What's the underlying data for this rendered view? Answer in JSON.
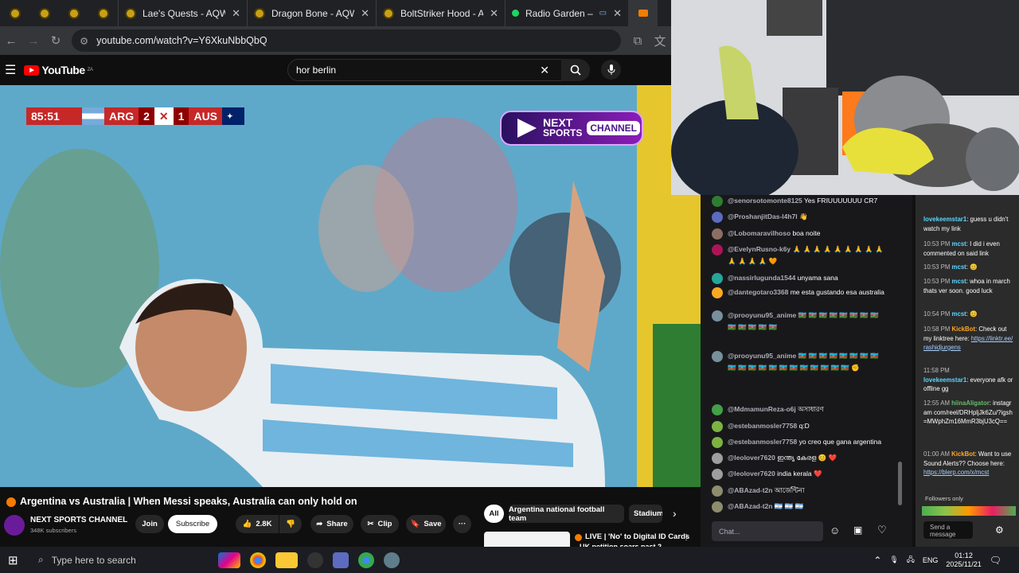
{
  "browser": {
    "tabs": [
      {
        "label": "Lae's Quests - AQW",
        "close": "✕"
      },
      {
        "label": "Dragon Bone - AQW",
        "close": "✕"
      },
      {
        "label": "BoltStriker Hood - AQW",
        "close": "✕"
      },
      {
        "label": "Radio Garden – Glob",
        "close": "✕"
      }
    ],
    "url": "youtube.com/watch?v=Y6XkuNbbQbQ"
  },
  "youtube": {
    "logo": "YouTube",
    "region": "ZA",
    "search_value": "hor berlin",
    "clear": "✕"
  },
  "video": {
    "clock": "85:51",
    "team1": "ARG",
    "score1": "2",
    "score2": "1",
    "team2": "AUS",
    "badge_line1": "NEXT",
    "badge_line2": "SPORTS",
    "badge_line3": "CHANNEL",
    "title": "Argentina vs Australia | When Messi speaks, Australia can only hold on",
    "channel_name": "NEXT SPORTS CHANNEL",
    "subscribers": "348K subscribers",
    "join": "Join",
    "subscribe": "Subscribe",
    "likes": "2.8K",
    "share": "Share",
    "clip": "Clip",
    "save": "Save",
    "more": "···"
  },
  "related": {
    "chips": [
      "All",
      "Argentina national football team",
      "Stadium"
    ],
    "next_title": "LIVE | 'No' to Digital ID Cards",
    "next_sub": "UK petition soars past 2"
  },
  "chat": {
    "messages": [
      {
        "user": "@senorsotomonte8125",
        "text": "Yes FRIUUUUUUU CR7",
        "color": "#2e7d32"
      },
      {
        "user": "@ProshanjitDas-l4h7l",
        "text": "👋",
        "color": "#5c6bc0"
      },
      {
        "user": "@Lobomaravilhoso",
        "text": "boa noite",
        "color": "#8d6e63"
      },
      {
        "user": "@EvelynRusno-k6y",
        "text": "🙏 🙏 🙏 🙏 🙏 🙏 🙏 🙏 🙏 🙏 🙏 🙏 🙏 🧡",
        "color": "#ad1457"
      },
      {
        "user": "@nassirlugunda1544",
        "text": "unyama sana",
        "color": "#26a69a"
      },
      {
        "user": "@dantegotaro3368",
        "text": "me esta gustando esa australia",
        "color": "#f9a825"
      },
      {
        "user": "@prooyunu95_anime",
        "text": "🇦🇿 🇦🇿 🇦🇿 🇦🇿 🇦🇿 🇦🇿 🇦🇿 🇦🇿 🇦🇿 🇦🇿 🇦🇿 🇦🇿 🇦🇿",
        "color": "#78909c"
      },
      {
        "user": "@prooyunu95_anime",
        "text": "🇦🇿 🇦🇿 🇦🇿 🇦🇿 🇦🇿 🇦🇿 🇦🇿 🇦🇿 🇦🇿 🇦🇿 🇦🇿 🇦🇿 🇦🇿 🇦🇿 🇦🇿 🇦🇿 🇦🇿 🇦🇿 🇦🇿 🇦🇿 ✊",
        "color": "#78909c"
      },
      {
        "user": "@MdmamunReza-o6j",
        "text": "অসাধারণ",
        "color": "#43a047"
      },
      {
        "user": "@estebanmosler7758",
        "text": "q:D",
        "color": "#7cb342"
      },
      {
        "user": "@estebanmosler7758",
        "text": "yo creo que gana argentina",
        "color": "#7cb342"
      },
      {
        "user": "@leolover7620",
        "text": "ഇന്ത്യ കേരള 😊 ❤️",
        "color": "#9e9e9e"
      },
      {
        "user": "@leolover7620",
        "text": "india kerala ❤️",
        "color": "#9e9e9e"
      },
      {
        "user": "@ABAzad-t2n",
        "text": "আর্জেন্টিনা",
        "color": "#8d8d6e"
      },
      {
        "user": "@ABAzad-t2n",
        "text": "🇦🇷 🇦🇷 🇦🇷",
        "color": "#8d8d6e"
      }
    ],
    "input_placeholder": "Chat..."
  },
  "side_chat": {
    "messages": [
      {
        "time": "",
        "name": "lovekeemstar1",
        "text": ": guess u didn't watch my link"
      },
      {
        "time": "10:53 PM",
        "name": "mcst",
        "text": ": I did i even commented on said link"
      },
      {
        "time": "10:53 PM",
        "name": "mcst",
        "text": ": 😊"
      },
      {
        "time": "10:53 PM",
        "name": "mcst",
        "text": ": whoa in march thats ver soon. good luck"
      },
      {
        "time": "10:54 PM",
        "name": "mcst",
        "text": ": 😊"
      },
      {
        "time": "10:58 PM",
        "name": "KickBot",
        "text": ": Check out my linktree here:",
        "link": "https://linktr.ee/rashidjurgens"
      },
      {
        "time": "11:58 PM",
        "name": "lovekeemstar1",
        "text": ": everyone afk or offline gg"
      },
      {
        "time": "12:55 AM",
        "name": "hiinaAligator",
        "text": ": instagram com/reel/DRHpljJk6Zu/?igsh=MWphZm16MmR3bjU3cQ=="
      },
      {
        "time": "01:00 AM",
        "name": "KickBot",
        "text": ": Want to use Sound Alerts?? Choose here:",
        "link": "https://blerp.com/x/mcst"
      }
    ],
    "followers_only": "Followers only",
    "send": "Send a message"
  },
  "taskbar": {
    "search_placeholder": "Type here to search",
    "language": "ENG",
    "time": "01:12",
    "date": "2025/11/21"
  }
}
